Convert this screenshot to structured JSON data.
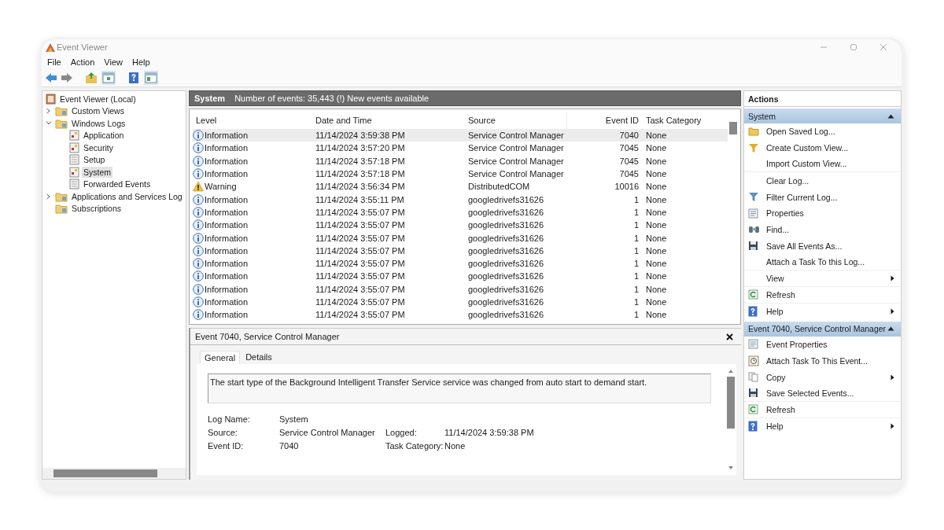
{
  "window": {
    "title": "Event Viewer"
  },
  "menu": [
    "File",
    "Action",
    "View",
    "Help"
  ],
  "log_tree": [
    {
      "label": "Event Viewer (Local)",
      "kind": "root",
      "selected": false,
      "children": [
        {
          "label": "Custom Views",
          "kind": "folder",
          "expanded": false,
          "selected": false
        },
        {
          "label": "Windows Logs",
          "kind": "folder",
          "expanded": true,
          "selected": false,
          "children": [
            {
              "label": "Application",
              "kind": "log",
              "selected": false
            },
            {
              "label": "Security",
              "kind": "log",
              "selected": false
            },
            {
              "label": "Setup",
              "kind": "plain-log",
              "selected": false
            },
            {
              "label": "System",
              "kind": "log",
              "selected": true
            },
            {
              "label": "Forwarded Events",
              "kind": "plain-log",
              "selected": false
            }
          ]
        },
        {
          "label": "Applications and Services Log",
          "kind": "folder",
          "expanded": false,
          "selected": false
        },
        {
          "label": "Subscriptions",
          "kind": "folder",
          "selected": false
        }
      ]
    }
  ],
  "log_header": {
    "title": "System",
    "summary": "Number of events: 35,443 (!) New events available"
  },
  "events": {
    "columns": [
      "Level",
      "Date and Time",
      "Source",
      "Event ID",
      "Task Category"
    ],
    "rows": [
      {
        "kind": "information",
        "level": "Information",
        "date": "11/14/2024 3:59:38 PM",
        "source": "Service Control Manager",
        "event_id": "7040",
        "task_category": "None",
        "selected": true
      },
      {
        "kind": "information",
        "level": "Information",
        "date": "11/14/2024 3:57:20 PM",
        "source": "Service Control Manager",
        "event_id": "7045",
        "task_category": "None",
        "selected": false
      },
      {
        "kind": "information",
        "level": "Information",
        "date": "11/14/2024 3:57:18 PM",
        "source": "Service Control Manager",
        "event_id": "7045",
        "task_category": "None",
        "selected": false
      },
      {
        "kind": "information",
        "level": "Information",
        "date": "11/14/2024 3:57:18 PM",
        "source": "Service Control Manager",
        "event_id": "7045",
        "task_category": "None",
        "selected": false
      },
      {
        "kind": "warning",
        "level": "Warning",
        "date": "11/14/2024 3:56:34 PM",
        "source": "DistributedCOM",
        "event_id": "10016",
        "task_category": "None",
        "selected": false
      },
      {
        "kind": "information",
        "level": "Information",
        "date": "11/14/2024 3:55:11 PM",
        "source": "googledrivefs31626",
        "event_id": "1",
        "task_category": "None",
        "selected": false
      },
      {
        "kind": "information",
        "level": "Information",
        "date": "11/14/2024 3:55:07 PM",
        "source": "googledrivefs31626",
        "event_id": "1",
        "task_category": "None",
        "selected": false
      },
      {
        "kind": "information",
        "level": "Information",
        "date": "11/14/2024 3:55:07 PM",
        "source": "googledrivefs31626",
        "event_id": "1",
        "task_category": "None",
        "selected": false
      },
      {
        "kind": "information",
        "level": "Information",
        "date": "11/14/2024 3:55:07 PM",
        "source": "googledrivefs31626",
        "event_id": "1",
        "task_category": "None",
        "selected": false
      },
      {
        "kind": "information",
        "level": "Information",
        "date": "11/14/2024 3:55:07 PM",
        "source": "googledrivefs31626",
        "event_id": "1",
        "task_category": "None",
        "selected": false
      },
      {
        "kind": "information",
        "level": "Information",
        "date": "11/14/2024 3:55:07 PM",
        "source": "googledrivefs31626",
        "event_id": "1",
        "task_category": "None",
        "selected": false
      },
      {
        "kind": "information",
        "level": "Information",
        "date": "11/14/2024 3:55:07 PM",
        "source": "googledrivefs31626",
        "event_id": "1",
        "task_category": "None",
        "selected": false
      },
      {
        "kind": "information",
        "level": "Information",
        "date": "11/14/2024 3:55:07 PM",
        "source": "googledrivefs31626",
        "event_id": "1",
        "task_category": "None",
        "selected": false
      },
      {
        "kind": "information",
        "level": "Information",
        "date": "11/14/2024 3:55:07 PM",
        "source": "googledrivefs31626",
        "event_id": "1",
        "task_category": "None",
        "selected": false
      },
      {
        "kind": "information",
        "level": "Information",
        "date": "11/14/2024 3:55:07 PM",
        "source": "googledrivefs31626",
        "event_id": "1",
        "task_category": "None",
        "selected": false
      }
    ]
  },
  "event_detail": {
    "title": "Event 7040, Service Control Manager",
    "tabs": [
      {
        "label": "General",
        "selected": true
      },
      {
        "label": "Details",
        "selected": false
      }
    ],
    "message": "The start type of the Background Intelligent Transfer Service service was changed from auto start to demand start.",
    "fields": [
      {
        "label": "Log Name:",
        "value": "System"
      },
      {
        "label": "Source:",
        "value": "Service Control Manager",
        "label_2": "Logged:",
        "value_2": "11/14/2024 3:59:38 PM"
      },
      {
        "label": "Event ID:",
        "value": "7040",
        "label_2": "Task Category:",
        "value_2": "None"
      }
    ]
  },
  "actions": {
    "title": "Actions",
    "sections": [
      {
        "title": "System",
        "expanded": true,
        "items": [
          {
            "label": "Open Saved Log...",
            "kind": "folder"
          },
          {
            "label": "Create Custom View...",
            "kind": "filter-new"
          },
          {
            "label": "Import Custom View...",
            "kind": "none",
            "separator_after": true
          },
          {
            "label": "Clear Log...",
            "kind": "none"
          },
          {
            "label": "Filter Current Log...",
            "kind": "filter"
          },
          {
            "label": "Properties",
            "kind": "properties"
          },
          {
            "label": "Find...",
            "kind": "find"
          },
          {
            "label": "Save All Events As...",
            "kind": "save"
          },
          {
            "label": "Attach a Task To this Log...",
            "kind": "none",
            "separator_after": true
          },
          {
            "label": "View",
            "kind": "none",
            "submenu": true,
            "separator_after": true
          },
          {
            "label": "Refresh",
            "kind": "refresh",
            "separator_after": true
          },
          {
            "label": "Help",
            "kind": "help",
            "submenu": true
          }
        ]
      },
      {
        "title": "Event 7040, Service Control Manager",
        "expanded": true,
        "items": [
          {
            "label": "Event Properties",
            "kind": "properties"
          },
          {
            "label": "Attach Task To This Event...",
            "kind": "task"
          },
          {
            "label": "Copy",
            "kind": "copy",
            "submenu": true
          },
          {
            "label": "Save Selected Events...",
            "kind": "save",
            "separator_after": true
          },
          {
            "label": "Refresh",
            "kind": "refresh",
            "separator_after": true
          },
          {
            "label": "Help",
            "kind": "help",
            "submenu": true
          }
        ]
      }
    ]
  }
}
